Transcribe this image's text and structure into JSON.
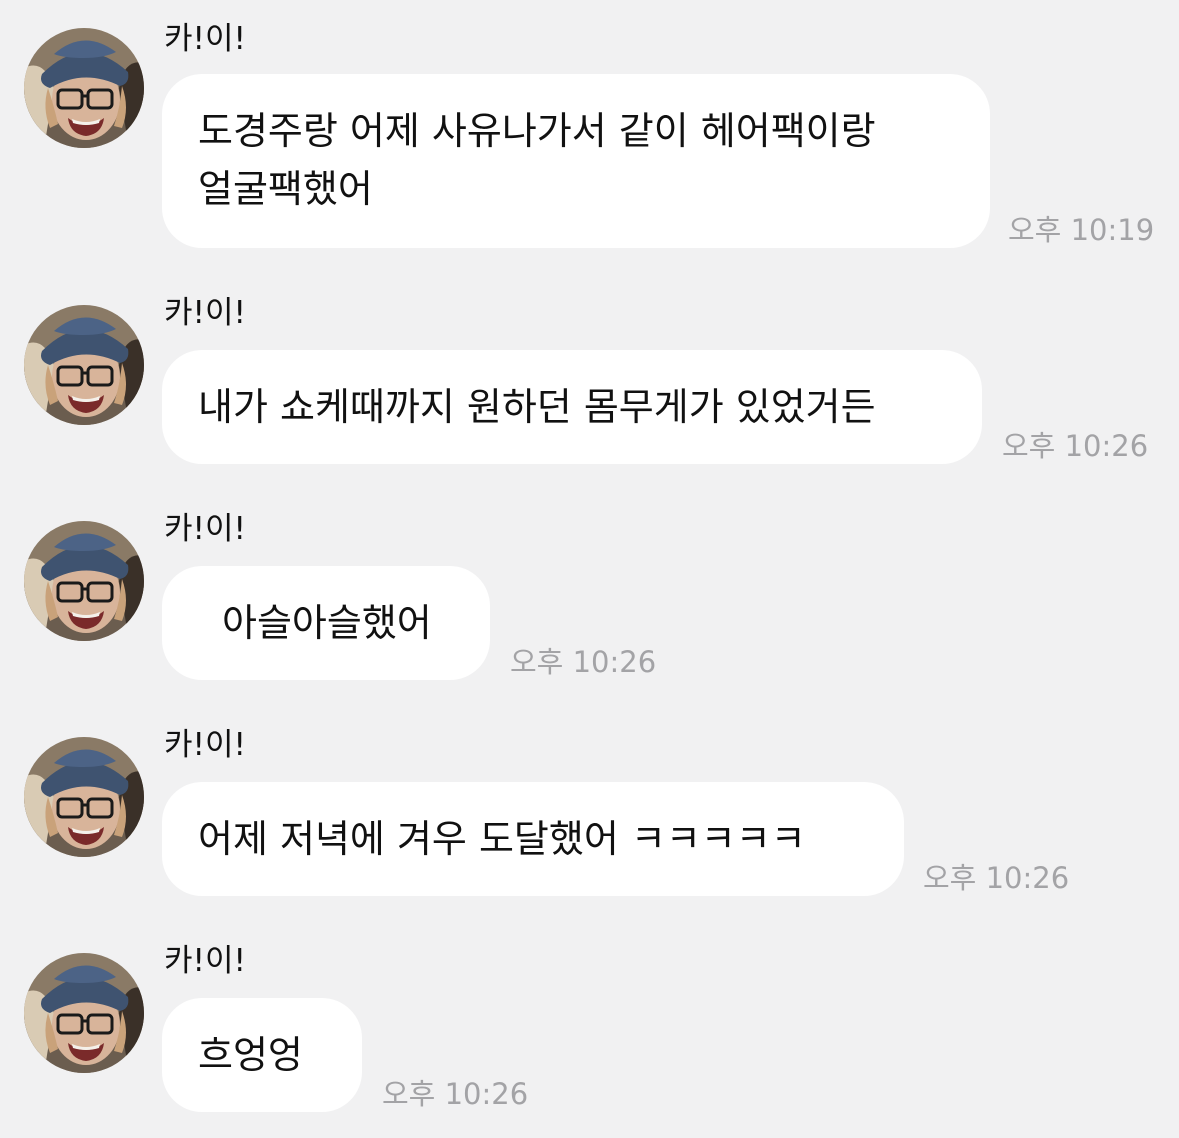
{
  "messages": [
    {
      "sender": "카!이!",
      "lines": [
        "도경주랑 어제 사유나가서 같이 헤어팩이랑",
        "얼굴팩했어"
      ],
      "time": "오후 10:19"
    },
    {
      "sender": "카!이!",
      "lines": [
        "내가 쇼케때까지 원하던 몸무게가 있었거든"
      ],
      "time": "오후 10:26"
    },
    {
      "sender": "카!이!",
      "lines": [
        "아슬아슬했어"
      ],
      "time": "오후 10:26"
    },
    {
      "sender": "카!이!",
      "lines": [
        "어제 저녁에 겨우 도달했어 ㅋㅋㅋㅋㅋ"
      ],
      "time": "오후 10:26"
    },
    {
      "sender": "카!이!",
      "lines": [
        "흐엉엉"
      ],
      "time": "오후 10:26"
    }
  ]
}
